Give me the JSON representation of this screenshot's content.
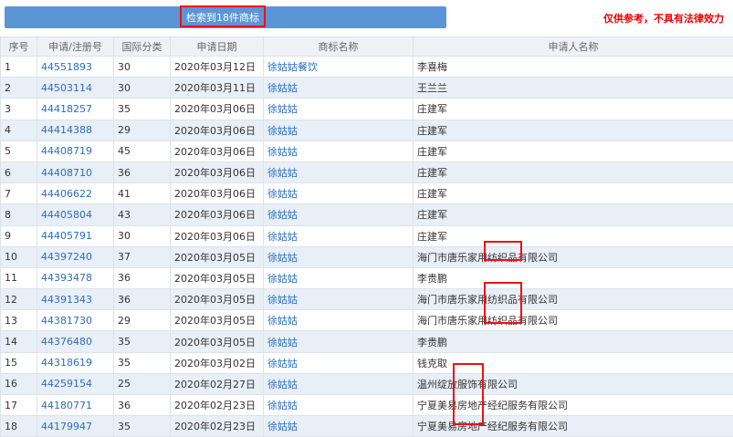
{
  "toolbar": {
    "search_result_label": "检索到18件商标",
    "disclaimer": "仅供参考，不具有法律效力"
  },
  "table": {
    "headers": [
      "序号",
      "申请/注册号",
      "国际分类",
      "申请日期",
      "商标名称",
      "申请人名称"
    ],
    "rows": [
      [
        "1",
        "44551893",
        "30",
        "2020年03月12日",
        "徐姑姑餐饮",
        "李喜梅"
      ],
      [
        "2",
        "44503114",
        "30",
        "2020年03月11日",
        "徐姑姑",
        "王兰兰"
      ],
      [
        "3",
        "44418257",
        "35",
        "2020年03月06日",
        "徐姑姑",
        "庄建军"
      ],
      [
        "4",
        "44414388",
        "29",
        "2020年03月06日",
        "徐姑姑",
        "庄建军"
      ],
      [
        "5",
        "44408719",
        "45",
        "2020年03月06日",
        "徐姑姑",
        "庄建军"
      ],
      [
        "6",
        "44408710",
        "36",
        "2020年03月06日",
        "徐姑姑",
        "庄建军"
      ],
      [
        "7",
        "44406622",
        "41",
        "2020年03月06日",
        "徐姑姑",
        "庄建军"
      ],
      [
        "8",
        "44405804",
        "43",
        "2020年03月06日",
        "徐姑姑",
        "庄建军"
      ],
      [
        "9",
        "44405791",
        "30",
        "2020年03月06日",
        "徐姑姑",
        "庄建军"
      ],
      [
        "10",
        "44397240",
        "37",
        "2020年03月05日",
        "徐姑姑",
        "海门市唐乐家用纺织品有限公司"
      ],
      [
        "11",
        "44393478",
        "36",
        "2020年03月05日",
        "徐姑姑",
        "李贵鹏"
      ],
      [
        "12",
        "44391343",
        "36",
        "2020年03月05日",
        "徐姑姑",
        "海门市唐乐家用纺织品有限公司"
      ],
      [
        "13",
        "44381730",
        "29",
        "2020年03月05日",
        "徐姑姑",
        "海门市唐乐家用纺织品有限公司"
      ],
      [
        "14",
        "44376480",
        "35",
        "2020年03月05日",
        "徐姑姑",
        "李贵鹏"
      ],
      [
        "15",
        "44318619",
        "35",
        "2020年03月02日",
        "徐姑姑",
        "钱克取"
      ],
      [
        "16",
        "44259154",
        "25",
        "2020年02月27日",
        "徐姑姑",
        "温州绽放服饰有限公司"
      ],
      [
        "17",
        "44180771",
        "36",
        "2020年02月23日",
        "徐姑姑",
        "宁夏美易房地产经纪服务有限公司"
      ],
      [
        "18",
        "44179947",
        "35",
        "2020年02月23日",
        "徐姑姑",
        "宁夏美易房地产经纪服务有限公司"
      ]
    ]
  },
  "colors": {
    "bar": "#5b95d6",
    "link": "#2b6dbf",
    "highlight": "#ee1111",
    "row_alt": "#e9eff7"
  }
}
